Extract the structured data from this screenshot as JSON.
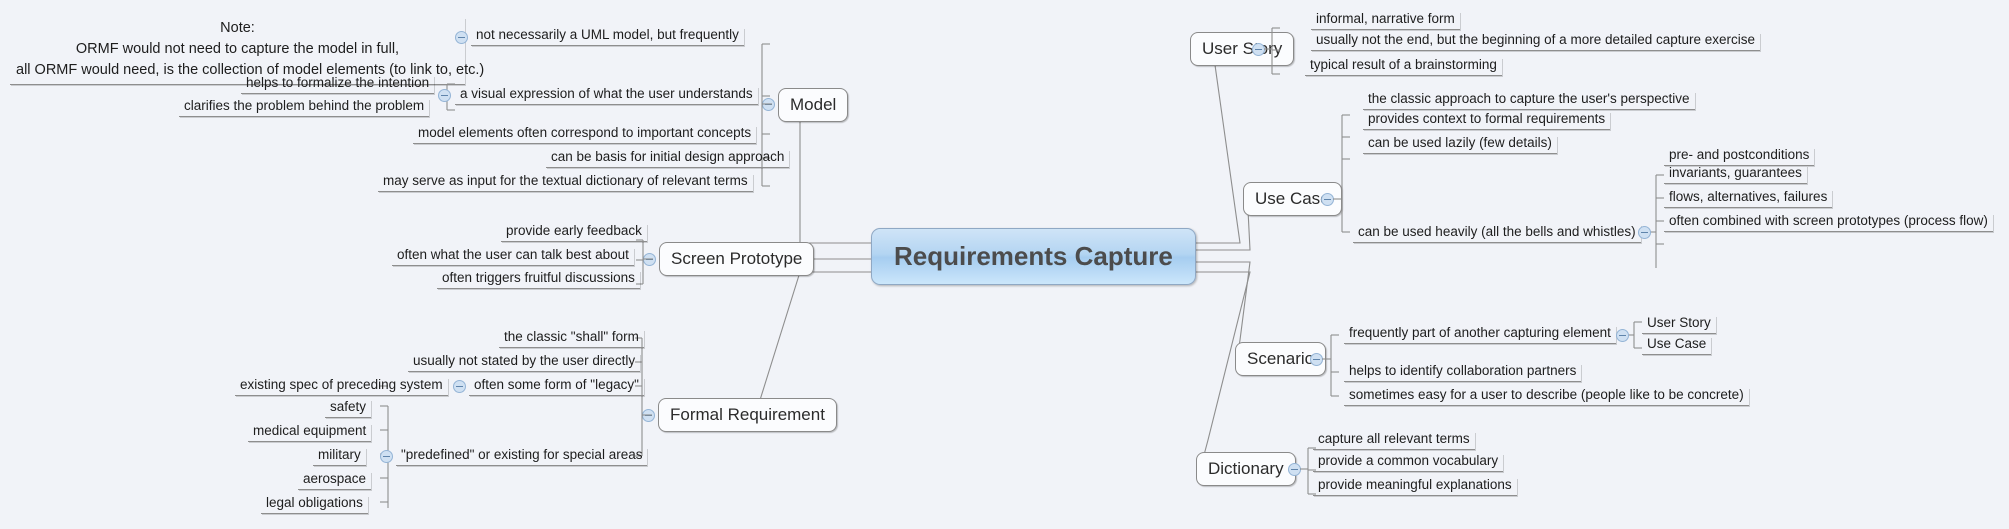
{
  "canvas": {
    "background": "#f1f3f8",
    "root_fill_top": "#cfe4f7",
    "root_fill_bottom": "#cbe6fb",
    "node_fill": "#fbfcfe",
    "edge_color": "#8e8e8e",
    "bubble_fill": "#cfe0f2",
    "bubble_stroke": "#94b4d6"
  },
  "root": {
    "label": "Requirements Capture"
  },
  "note": {
    "line1": "Note:",
    "line2": "ORMF would not need to capture the model in full,",
    "line3": "all ORMF would need, is the collection of model elements (to link to, etc.)"
  },
  "branches": {
    "model": {
      "label": "Model",
      "children": [
        {
          "label": "not necessarily a UML model, but frequently"
        },
        {
          "label": "a visual expression of what the user understands",
          "children": [
            {
              "label": "helps to formalize the intention"
            },
            {
              "label": "clarifies the problem behind the problem"
            }
          ]
        },
        {
          "label": "model elements often correspond to important concepts"
        },
        {
          "label": "can be basis for initial design approach"
        },
        {
          "label": "may serve as input for the textual dictionary of relevant terms"
        }
      ]
    },
    "screen_prototype": {
      "label": "Screen Prototype",
      "children": [
        {
          "label": "provide early feedback"
        },
        {
          "label": "often what the user can talk best about"
        },
        {
          "label": "often triggers fruitful discussions"
        }
      ]
    },
    "formal_requirement": {
      "label": "Formal Requirement",
      "children": [
        {
          "label": "the classic \"shall\" form"
        },
        {
          "label": "usually not stated by the user directly"
        },
        {
          "label": "often some form of \"legacy\"",
          "children": [
            {
              "label": "existing spec of preceding system"
            }
          ]
        },
        {
          "label": "\"predefined\" or existing for special areas",
          "children": [
            {
              "label": "safety"
            },
            {
              "label": "medical equipment"
            },
            {
              "label": "military"
            },
            {
              "label": "aerospace"
            },
            {
              "label": "legal obligations"
            }
          ]
        }
      ]
    },
    "user_story": {
      "label": "User Story",
      "children": [
        {
          "label": "informal, narrative form"
        },
        {
          "label": "usually not the end, but the beginning of a more detailed capture exercise"
        },
        {
          "label": "typical result of a brainstorming"
        }
      ]
    },
    "use_case": {
      "label": "Use Case",
      "children": [
        {
          "label": "the classic approach to capture the user's perspective"
        },
        {
          "label": "provides context to formal requirements"
        },
        {
          "label": "can be used lazily (few details)"
        },
        {
          "label": "can be used heavily (all the bells and whistles)",
          "children": [
            {
              "label": "pre- and postconditions"
            },
            {
              "label": "invariants, guarantees"
            },
            {
              "label": "flows, alternatives, failures"
            },
            {
              "label": "often combined with screen prototypes (process flow)"
            }
          ]
        }
      ]
    },
    "scenario": {
      "label": "Scenario",
      "children": [
        {
          "label": "frequently part of another capturing element",
          "children": [
            {
              "label": "User Story"
            },
            {
              "label": "Use Case"
            }
          ]
        },
        {
          "label": "helps to identify collaboration partners"
        },
        {
          "label": "sometimes easy for a user to describe (people like to be concrete)"
        }
      ]
    },
    "dictionary": {
      "label": "Dictionary",
      "children": [
        {
          "label": "capture all relevant terms"
        },
        {
          "label": "provide a common vocabulary"
        },
        {
          "label": "provide meaningful explanations"
        }
      ]
    }
  }
}
